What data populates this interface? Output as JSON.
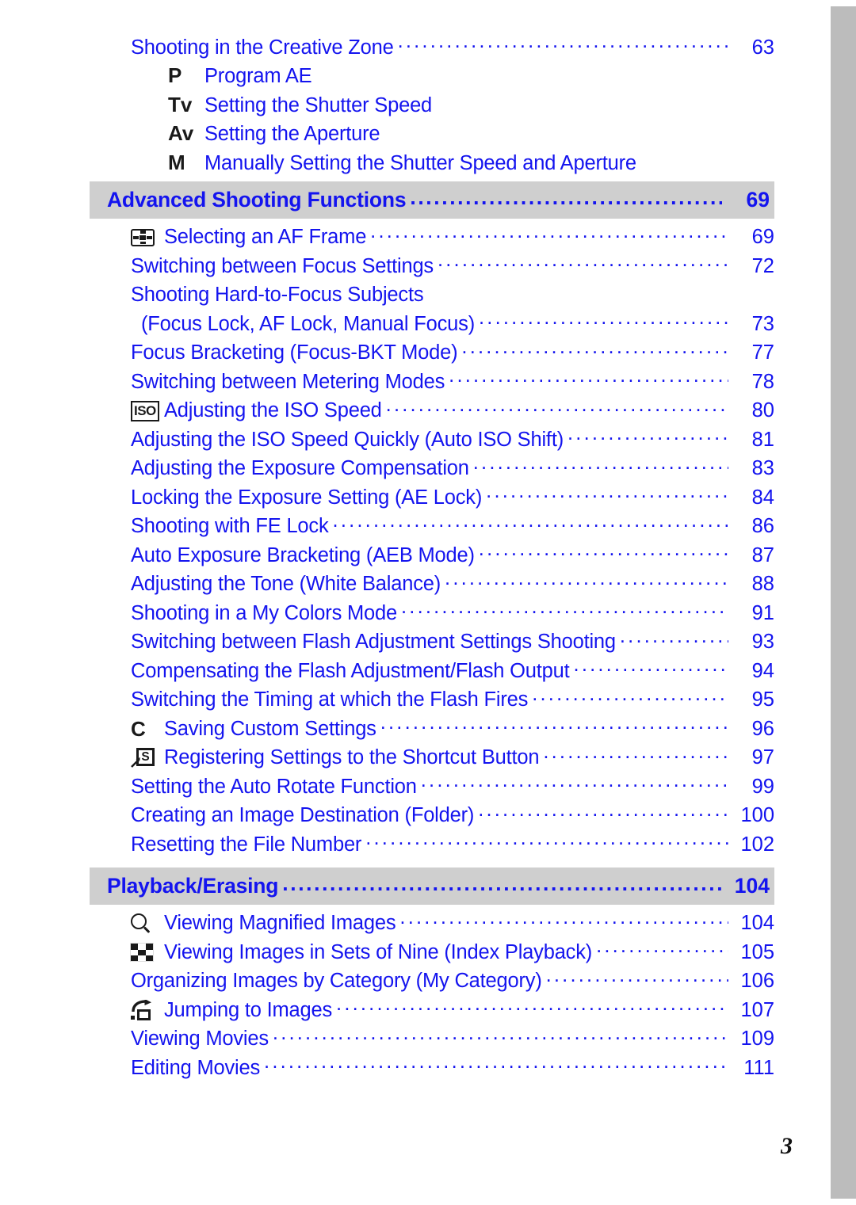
{
  "colors": {
    "link_blue": "#1414ef",
    "band_gray": "#cfcfcf",
    "tab_gray": "#bcbcbc",
    "icon_black": "#1a1a1a"
  },
  "folio": "3",
  "toc": {
    "top_entries": [
      {
        "label": "Shooting in the Creative Zone",
        "page": "63",
        "icon": null,
        "leader": true
      },
      {
        "label": "Program AE",
        "page": "",
        "icon": "mode-P",
        "leader": false
      },
      {
        "label": "Setting the Shutter Speed",
        "page": "",
        "icon": "mode-Tv",
        "leader": false
      },
      {
        "label": "Setting the Aperture",
        "page": "",
        "icon": "mode-Av",
        "leader": false
      },
      {
        "label": "Manually Setting the Shutter Speed and Aperture",
        "page": "",
        "icon": "mode-M",
        "leader": false
      }
    ],
    "sections": [
      {
        "title": "Advanced Shooting Functions",
        "page": "69",
        "entries": [
          {
            "label": "Selecting an AF Frame",
            "page": "69",
            "icon": "af-frame-icon",
            "leader": true
          },
          {
            "label": "Switching between Focus Settings",
            "page": "72",
            "icon": null,
            "leader": true
          },
          {
            "label": "Shooting Hard-to-Focus Subjects",
            "page": "",
            "icon": null,
            "leader": false
          },
          {
            "label": "(Focus Lock, AF Lock, Manual Focus)",
            "page": "73",
            "icon": null,
            "leader": true,
            "indent": "sub"
          },
          {
            "label": "Focus Bracketing (Focus-BKT Mode)",
            "page": "77",
            "icon": null,
            "leader": true
          },
          {
            "label": "Switching between Metering Modes",
            "page": "78",
            "icon": null,
            "leader": true
          },
          {
            "label": "Adjusting the ISO Speed",
            "page": "80",
            "icon": "iso-icon",
            "leader": true
          },
          {
            "label": "Adjusting the ISO Speed Quickly (Auto ISO Shift)",
            "page": "81",
            "icon": null,
            "leader": true
          },
          {
            "label": "Adjusting the Exposure Compensation",
            "page": "83",
            "icon": null,
            "leader": true
          },
          {
            "label": "Locking the Exposure Setting (AE Lock)",
            "page": "84",
            "icon": null,
            "leader": true
          },
          {
            "label": "Shooting with FE Lock",
            "page": "86",
            "icon": null,
            "leader": true
          },
          {
            "label": "Auto Exposure Bracketing (AEB Mode)",
            "page": "87",
            "icon": null,
            "leader": true
          },
          {
            "label": "Adjusting the Tone (White Balance)",
            "page": "88",
            "icon": null,
            "leader": true
          },
          {
            "label": "Shooting in a My Colors Mode",
            "page": "91",
            "icon": null,
            "leader": true
          },
          {
            "label": "Switching between Flash Adjustment Settings Shooting",
            "page": "93",
            "icon": null,
            "leader": true
          },
          {
            "label": "Compensating the Flash Adjustment/Flash Output",
            "page": "94",
            "icon": null,
            "leader": true
          },
          {
            "label": "Switching the Timing at which the Flash Fires",
            "page": "95",
            "icon": null,
            "leader": true
          },
          {
            "label": "Saving Custom Settings",
            "page": "96",
            "icon": "mode-C",
            "leader": true
          },
          {
            "label": "Registering Settings to the Shortcut Button",
            "page": "97",
            "icon": "shortcut-icon",
            "leader": true
          },
          {
            "label": "Setting the Auto Rotate Function",
            "page": "99",
            "icon": null,
            "leader": true
          },
          {
            "label": "Creating an Image Destination (Folder)",
            "page": "100",
            "icon": null,
            "leader": true
          },
          {
            "label": "Resetting the File Number",
            "page": "102",
            "icon": null,
            "leader": true
          }
        ]
      },
      {
        "title": "Playback/Erasing",
        "page": "104",
        "entries": [
          {
            "label": "Viewing Magnified Images",
            "page": "104",
            "icon": "magnifier-icon",
            "leader": true
          },
          {
            "label": "Viewing Images in Sets of Nine (Index Playback)",
            "page": "105",
            "icon": "index-playback-icon",
            "leader": true
          },
          {
            "label": "Organizing Images by Category (My Category)",
            "page": "106",
            "icon": null,
            "leader": true
          },
          {
            "label": "Jumping to Images",
            "page": "107",
            "icon": "jump-icon",
            "leader": true
          },
          {
            "label": "Viewing Movies",
            "page": "109",
            "icon": null,
            "leader": true
          },
          {
            "label": "Editing Movies",
            "page": "111",
            "icon": null,
            "leader": true
          }
        ]
      }
    ],
    "mode_letters": {
      "P": "P",
      "Tv": "Tv",
      "Av": "Av",
      "M": "M",
      "C": "C"
    },
    "iso_icon_text": "ISO",
    "shortcut_icon_text": "S"
  }
}
